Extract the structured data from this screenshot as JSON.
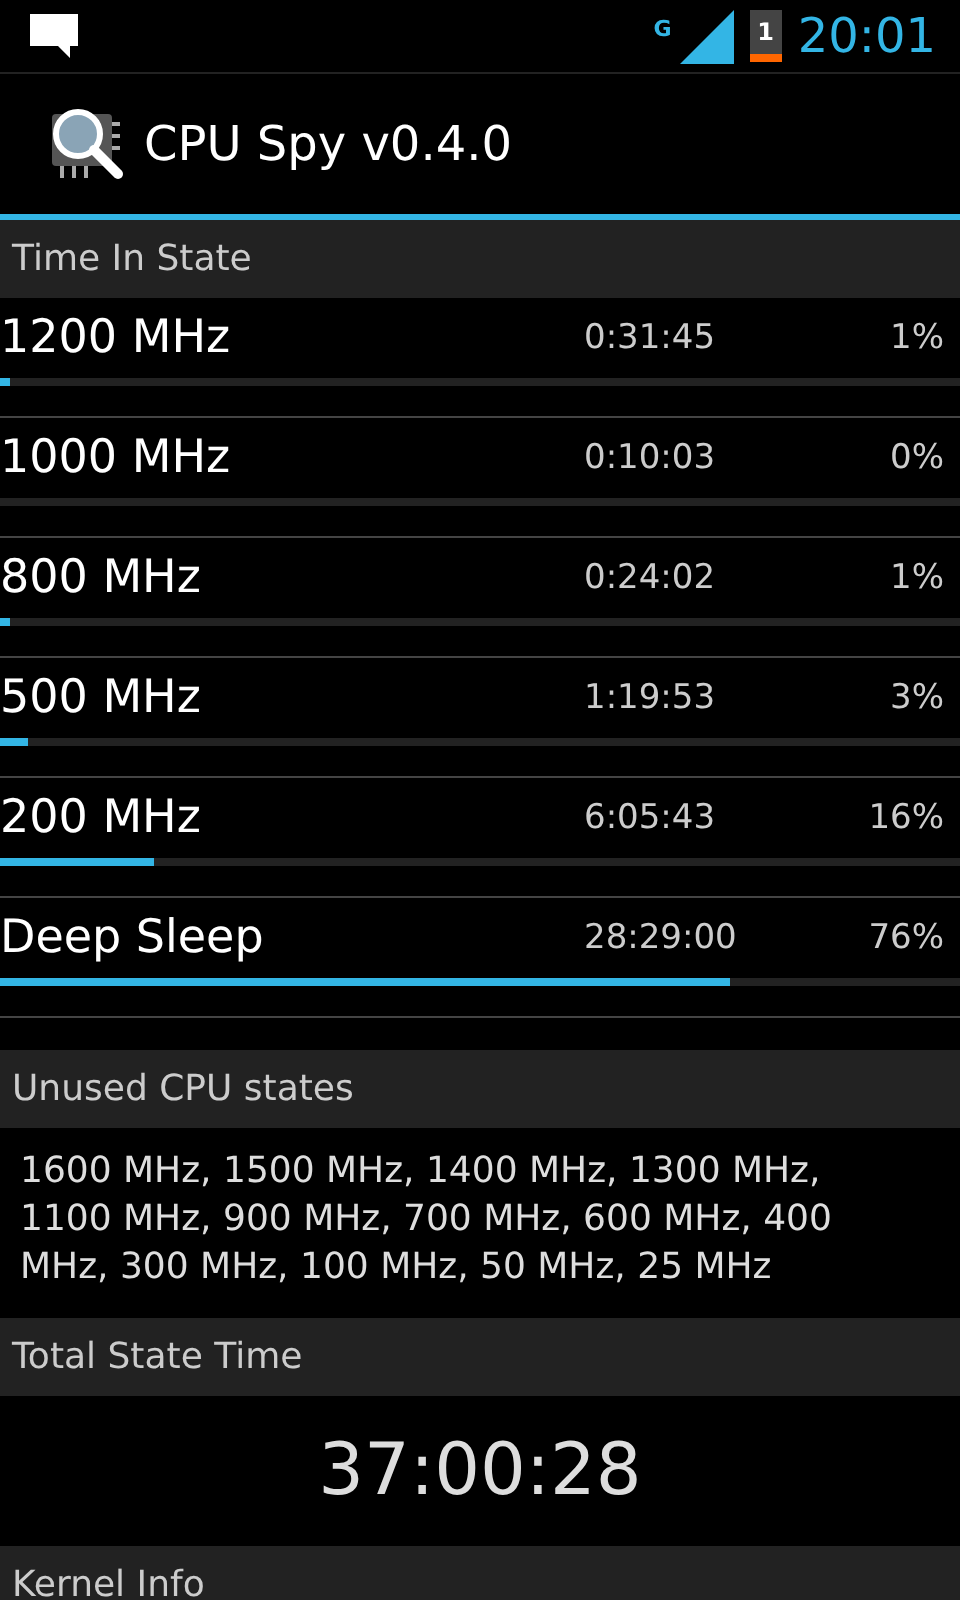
{
  "status_bar": {
    "network": "G",
    "battery": "1",
    "time": "20:01"
  },
  "app_bar": {
    "title": "CPU Spy v0.4.0"
  },
  "time_in_state": {
    "header": "Time In State",
    "rows": [
      {
        "name": "1200 MHz",
        "time": "0:31:45",
        "percent": "1%",
        "level": 0.01
      },
      {
        "name": "1000 MHz",
        "time": "0:10:03",
        "percent": "0%"
      },
      {
        "name": "800 MHz",
        "time": "0:24:02",
        "percent": "1%",
        "level": 0.01
      },
      {
        "name": "500 MHz",
        "time": "1:19:53",
        "percent": "3%",
        "level": 0.03
      },
      {
        "name": "200 MHz",
        "time": "6:05:43",
        "percent": "16%",
        "level": 0.16
      },
      {
        "name": "Deep Sleep",
        "time": "28:29:00",
        "percent": "76%",
        "level": 0.76
      }
    ]
  },
  "unused_states": {
    "header": "Unused CPU states",
    "text": "1600 MHz, 1500 MHz, 1400 MHz, 1300 MHz, 1100 MHz, 900 MHz, 700 MHz, 600 MHz, 400 MHz, 300 MHz, 100 MHz, 50 MHz, 25 MHz"
  },
  "total_state_time": {
    "header": "Total State Time",
    "value": "37:00:28"
  },
  "kernel_info": {
    "header": "Kernel Info"
  }
}
